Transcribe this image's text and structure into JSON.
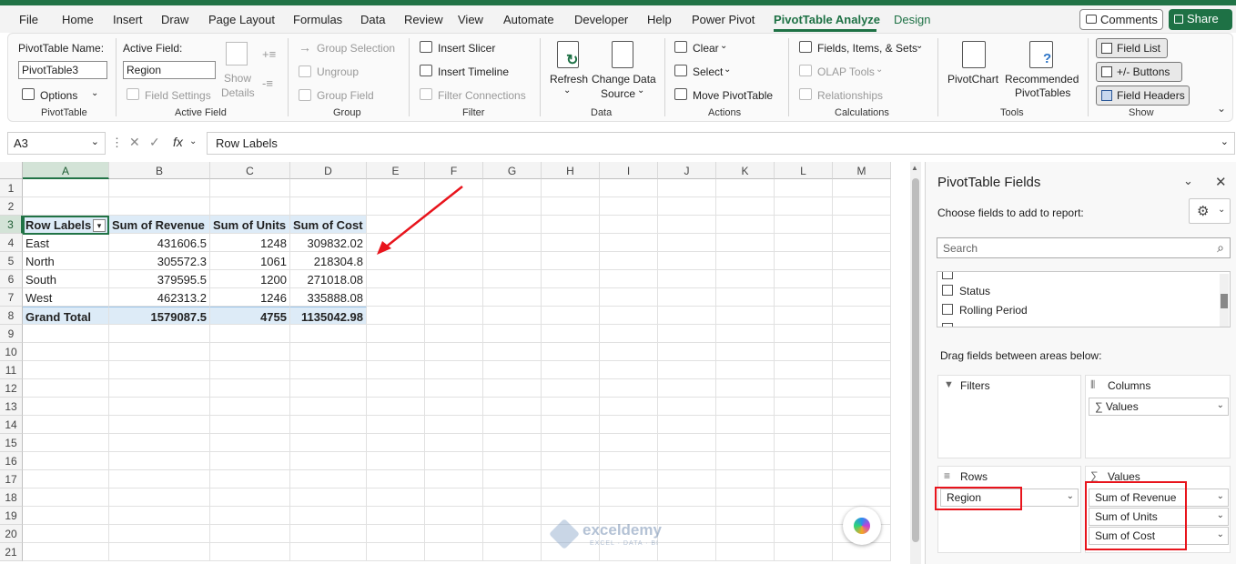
{
  "tabs": [
    "File",
    "Home",
    "Insert",
    "Draw",
    "Page Layout",
    "Formulas",
    "Data",
    "Review",
    "View",
    "Automate",
    "Developer",
    "Help",
    "Power Pivot",
    "PivotTable Analyze",
    "Design"
  ],
  "comments_label": "Comments",
  "share_label": "Share",
  "ribbon": {
    "pt_name_label": "PivotTable Name:",
    "pt_name_value": "PivotTable3",
    "options_label": "Options",
    "group_pivottable": "PivotTable",
    "active_field_label": "Active Field:",
    "active_field_value": "Region",
    "field_settings": "Field Settings",
    "show_details_1": "Show",
    "show_details_2": "Details",
    "group_active_field": "Active Field",
    "group_selection": "Group Selection",
    "ungroup": "Ungroup",
    "group_field": "Group Field",
    "group_group": "Group",
    "insert_slicer": "Insert Slicer",
    "insert_timeline": "Insert Timeline",
    "filter_connections": "Filter Connections",
    "group_filter": "Filter",
    "refresh": "Refresh",
    "change_data_1": "Change Data",
    "change_data_2": "Source",
    "group_data": "Data",
    "clear": "Clear",
    "select": "Select",
    "move_pivottable": "Move PivotTable",
    "group_actions": "Actions",
    "fields_items_sets": "Fields, Items, & Sets",
    "olap_tools": "OLAP Tools",
    "relationships": "Relationships",
    "group_calculations": "Calculations",
    "pivotchart": "PivotChart",
    "recommended_1": "Recommended",
    "recommended_2": "PivotTables",
    "group_tools": "Tools",
    "field_list": "Field List",
    "buttons": "+/- Buttons",
    "field_headers": "Field Headers",
    "group_show": "Show"
  },
  "name_box": "A3",
  "fx": "fx",
  "formula_value": "Row Labels",
  "columns": [
    "A",
    "B",
    "C",
    "D",
    "E",
    "F",
    "G",
    "H",
    "I",
    "J",
    "K",
    "L",
    "M"
  ],
  "rows": [
    "1",
    "2",
    "3",
    "4",
    "5",
    "6",
    "7",
    "8",
    "9",
    "10",
    "11",
    "12",
    "13",
    "14",
    "15",
    "16",
    "17",
    "18",
    "19",
    "20",
    "21"
  ],
  "pivot": {
    "headers": [
      "Row Labels",
      "Sum of Revenue",
      "Sum of Units",
      "Sum of Cost"
    ],
    "data": [
      [
        "East",
        "431606.5",
        "1248",
        "309832.02"
      ],
      [
        "North",
        "305572.3",
        "1061",
        "218304.8"
      ],
      [
        "South",
        "379595.5",
        "1200",
        "271018.08"
      ],
      [
        "West",
        "462313.2",
        "1246",
        "335888.08"
      ]
    ],
    "total": [
      "Grand Total",
      "1579087.5",
      "4755",
      "1135042.98"
    ]
  },
  "pane": {
    "title": "PivotTable Fields",
    "subtitle": "Choose fields to add to report:",
    "search_placeholder": "Search",
    "fields": [
      "Status",
      "Rolling Period"
    ],
    "drag_label": "Drag fields between areas below:",
    "filters_label": "Filters",
    "columns_label": "Columns",
    "columns_item": "Values",
    "rows_label": "Rows",
    "rows_item": "Region",
    "values_label": "Values",
    "values_items": [
      "Sum of Revenue",
      "Sum of Units",
      "Sum of Cost"
    ]
  },
  "watermark": {
    "brand": "exceldemy",
    "tagline": "EXCEL · DATA · BI"
  },
  "colors": {
    "excel_green": "#217346",
    "pivot_blue": "#ddebf7",
    "highlight_red": "#e8141c"
  }
}
